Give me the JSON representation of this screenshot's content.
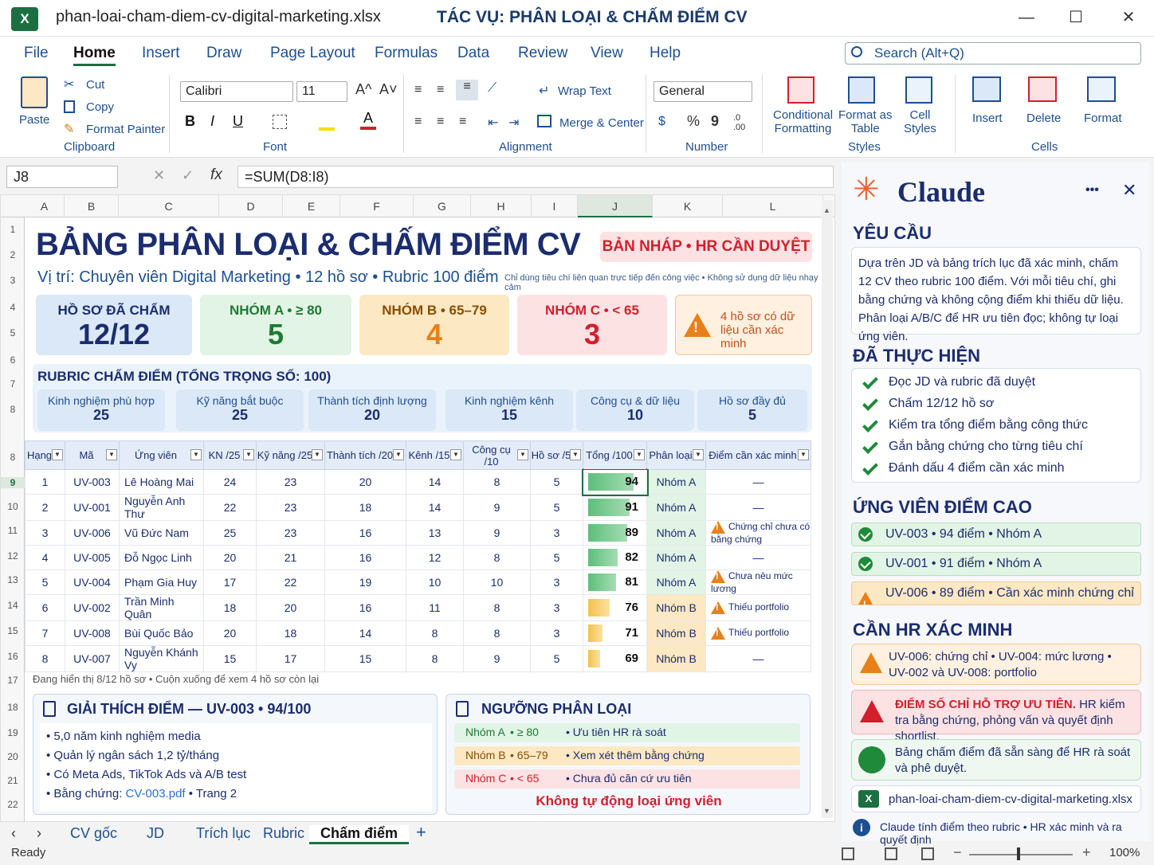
{
  "window": {
    "app_icon": "X",
    "file_name": "phan-loai-cham-diem-cv-digital-marketing.xlsx",
    "task_title": "TÁC VỤ: PHÂN LOẠI & CHẤM ĐIỂM CV",
    "min": "—",
    "max": "☐",
    "close": "✕"
  },
  "menu": {
    "items": [
      "File",
      "Home",
      "Insert",
      "Draw",
      "Page Layout",
      "Formulas",
      "Data",
      "Review",
      "View",
      "Help"
    ],
    "search_placeholder": "Search (Alt+Q)"
  },
  "ribbon": {
    "paste": "Paste",
    "cut": "Cut",
    "copy": "Copy",
    "format_painter": "Format Painter",
    "clipboard": "Clipboard",
    "font_name": "Calibri",
    "font_size": "11",
    "font": "Font",
    "wrap_text": "Wrap Text",
    "merge_center": "Merge & Center",
    "alignment": "Alignment",
    "number_format": "General",
    "number": "Number",
    "conditional_formatting_1": "Conditional",
    "conditional_formatting_2": "Formatting",
    "format_as_table_1": "Format as",
    "format_as_table_2": "Table",
    "cell_styles_1": "Cell",
    "cell_styles_2": "Styles",
    "styles": "Styles",
    "insert": "Insert",
    "delete": "Delete",
    "format": "Format",
    "cells": "Cells",
    "bold": "B",
    "italic": "I",
    "underline": "U",
    "percent": "%",
    "comma": "9"
  },
  "formula_bar": {
    "name_box": "J8",
    "formula": "=SUM(D8:I8)",
    "fx": "fx"
  },
  "columns": [
    "A",
    "B",
    "C",
    "D",
    "E",
    "F",
    "G",
    "H",
    "I",
    "J",
    "K",
    "L"
  ],
  "rows": [
    "1",
    "2",
    "3",
    "4",
    "5",
    "6",
    "7",
    "8",
    "8",
    "9",
    "10",
    "11",
    "12",
    "13",
    "14",
    "15",
    "16",
    "17",
    "18",
    "19",
    "20",
    "21",
    "22"
  ],
  "sheet": {
    "title": "BẢNG PHÂN LOẠI & CHẤM ĐIỂM CV",
    "subtitle": "Vị trí: Chuyên viên Digital Marketing • 12 hồ sơ • Rubric 100 điểm",
    "draft_badge": "BẢN NHÁP • HR CẦN DUYỆT",
    "small_note": "Chỉ dùng tiêu chí liên quan trực tiếp đến công việc • Không sử dụng dữ liệu nhạy cảm",
    "cards": [
      {
        "label": "HỒ SƠ ĐÃ CHẤM",
        "value": "12/12"
      },
      {
        "label": "NHÓM A • ≥ 80",
        "value": "5"
      },
      {
        "label": "NHÓM B • 65–79",
        "value": "4"
      },
      {
        "label": "NHÓM C • < 65",
        "value": "3"
      }
    ],
    "warning_card": "4 hồ sơ có dữ liệu cần xác minh",
    "rubric_title": "RUBRIC CHẤM ĐIỂM (TỔNG TRỌNG SỐ: 100)",
    "rubric": [
      {
        "name": "Kinh nghiệm phù hợp",
        "weight": "25"
      },
      {
        "name": "Kỹ năng bắt buộc",
        "weight": "25"
      },
      {
        "name": "Thành tích định lượng",
        "weight": "20"
      },
      {
        "name": "Kinh nghiệm kênh",
        "weight": "15"
      },
      {
        "name": "Công cụ & dữ liệu",
        "weight": "10"
      },
      {
        "name": "Hồ sơ đầy đủ",
        "weight": "5"
      }
    ],
    "table_headers": [
      "Hạng",
      "Mã",
      "Ứng viên",
      "KN /25",
      "Kỹ năng /25",
      "Thành tích /20",
      "Kênh /15",
      "Công cụ /10",
      "Hồ sơ /5",
      "Tổng /100",
      "Phân loại",
      "Điểm cần xác minh"
    ],
    "table_rows": [
      {
        "rank": "1",
        "code": "UV-003",
        "name": "Lê Hoàng Mai",
        "kn": "24",
        "kn2": "23",
        "tt": "20",
        "kenh": "14",
        "cc": "8",
        "hs": "5",
        "total": "94",
        "cls": "Nhóm A",
        "note": "—",
        "warn": false
      },
      {
        "rank": "2",
        "code": "UV-001",
        "name": "Nguyễn Anh Thư",
        "kn": "22",
        "kn2": "23",
        "tt": "18",
        "kenh": "14",
        "cc": "9",
        "hs": "5",
        "total": "91",
        "cls": "Nhóm A",
        "note": "—",
        "warn": false
      },
      {
        "rank": "3",
        "code": "UV-006",
        "name": "Vũ Đức Nam",
        "kn": "25",
        "kn2": "23",
        "tt": "16",
        "kenh": "13",
        "cc": "9",
        "hs": "3",
        "total": "89",
        "cls": "Nhóm A",
        "note": "Chứng chỉ chưa có bằng chứng",
        "warn": true
      },
      {
        "rank": "4",
        "code": "UV-005",
        "name": "Đỗ Ngọc Linh",
        "kn": "20",
        "kn2": "21",
        "tt": "16",
        "kenh": "12",
        "cc": "8",
        "hs": "5",
        "total": "82",
        "cls": "Nhóm A",
        "note": "—",
        "warn": false
      },
      {
        "rank": "5",
        "code": "UV-004",
        "name": "Phạm Gia Huy",
        "kn": "17",
        "kn2": "22",
        "tt": "19",
        "kenh": "10",
        "cc": "10",
        "hs": "3",
        "total": "81",
        "cls": "Nhóm A",
        "note": "Chưa nêu mức lương",
        "warn": true
      },
      {
        "rank": "6",
        "code": "UV-002",
        "name": "Trần Minh Quân",
        "kn": "18",
        "kn2": "20",
        "tt": "16",
        "kenh": "11",
        "cc": "8",
        "hs": "3",
        "total": "76",
        "cls": "Nhóm B",
        "note": "Thiếu portfolio",
        "warn": true
      },
      {
        "rank": "7",
        "code": "UV-008",
        "name": "Bùi Quốc Bảo",
        "kn": "20",
        "kn2": "18",
        "tt": "14",
        "kenh": "8",
        "cc": "8",
        "hs": "3",
        "total": "71",
        "cls": "Nhóm B",
        "note": "Thiếu portfolio",
        "warn": true
      },
      {
        "rank": "8",
        "code": "UV-007",
        "name": "Nguyễn Khánh Vy",
        "kn": "15",
        "kn2": "17",
        "tt": "15",
        "kenh": "8",
        "cc": "9",
        "hs": "5",
        "total": "69",
        "cls": "Nhóm B",
        "note": "—",
        "warn": false
      }
    ],
    "status_note": "Đang hiển thị 8/12 hồ sơ  •  Cuộn xuống để xem 4 hồ sơ còn lại",
    "explain_title": "GIẢI THÍCH ĐIỂM — UV-003 • 94/100",
    "explain_items": [
      "5,0 năm kinh nghiệm media",
      "Quản lý ngân sách 1,2 tỷ/tháng",
      "Có Meta Ads, TikTok Ads và A/B test"
    ],
    "evidence_label": "Bằng chứng:",
    "evidence_link": "CV-003.pdf",
    "evidence_page": "• Trang 2",
    "threshold_title": "NGƯỠNG PHÂN LOẠI",
    "thresholds": [
      {
        "grp": "Nhóm A",
        "rule": "•  ≥ 80",
        "desc": "•  Ưu tiên HR rà soát"
      },
      {
        "grp": "Nhóm B",
        "rule": "•  65–79",
        "desc": "•  Xem xét thêm bằng chứng"
      },
      {
        "grp": "Nhóm C",
        "rule": "•  < 65",
        "desc": "•  Chưa đủ căn cứ ưu tiên"
      }
    ],
    "no_auto": "Không tự động loại ứng viên"
  },
  "tabs": [
    "CV gốc",
    "JD",
    "Trích lục",
    "Rubric",
    "Chấm điểm",
    "+"
  ],
  "statusbar": {
    "ready": "Ready",
    "zoom": "100%"
  },
  "side": {
    "brand": "Claude",
    "more": "•••",
    "close": "✕",
    "request_title": "YÊU CẦU",
    "request_text": "Dựa trên JD và bảng trích lục đã xác minh, chấm 12 CV theo rubric 100 điểm. Với mỗi tiêu chí, ghi bằng chứng và không cộng điểm khi thiếu dữ liệu. Phân loại A/B/C để HR ưu tiên đọc; không tự loại ứng viên.",
    "done_title": "ĐÃ THỰC HIỆN",
    "done_items": [
      "Đọc JD và rubric đã duyệt",
      "Chấm 12/12 hồ sơ",
      "Kiểm tra tổng điểm bằng công thức",
      "Gắn bằng chứng cho từng tiêu chí",
      "Đánh dấu 4 điểm cần xác minh"
    ],
    "top_title": "ỨNG VIÊN ĐIỂM CAO",
    "top_items": [
      "UV-003  •  94 điểm  •  Nhóm A",
      "UV-001  •  91 điểm  •  Nhóm A",
      "UV-006  •  89 điểm  •  Cần xác minh chứng chỉ"
    ],
    "verify_title": "CẦN HR XÁC MINH",
    "verify_text": "UV-006: chứng chỉ  •  UV-004: mức lương  •  UV-002 và UV-008: portfolio",
    "alert_strong": "ĐIỂM SỐ CHỈ HỖ TRỢ ƯU TIÊN.",
    "alert_rest": "HR kiểm tra bằng chứng, phỏng vấn và quyết định shortlist.",
    "ok_text": "Bảng chấm điểm đã sẵn sàng để HR rà soát và phê duyệt.",
    "file_name": "phan-loai-cham-diem-cv-digital-marketing.xlsx",
    "footer": "Claude tính điểm theo rubric  •  HR xác minh và ra quyết định"
  },
  "colors": {
    "excel_green": "#1d6f42",
    "navy": "#1b2d6e",
    "claude_orange": "#e8612c",
    "group_a": "#e2f4e5",
    "group_b": "#fde8c4",
    "group_c": "#fde2e4"
  }
}
